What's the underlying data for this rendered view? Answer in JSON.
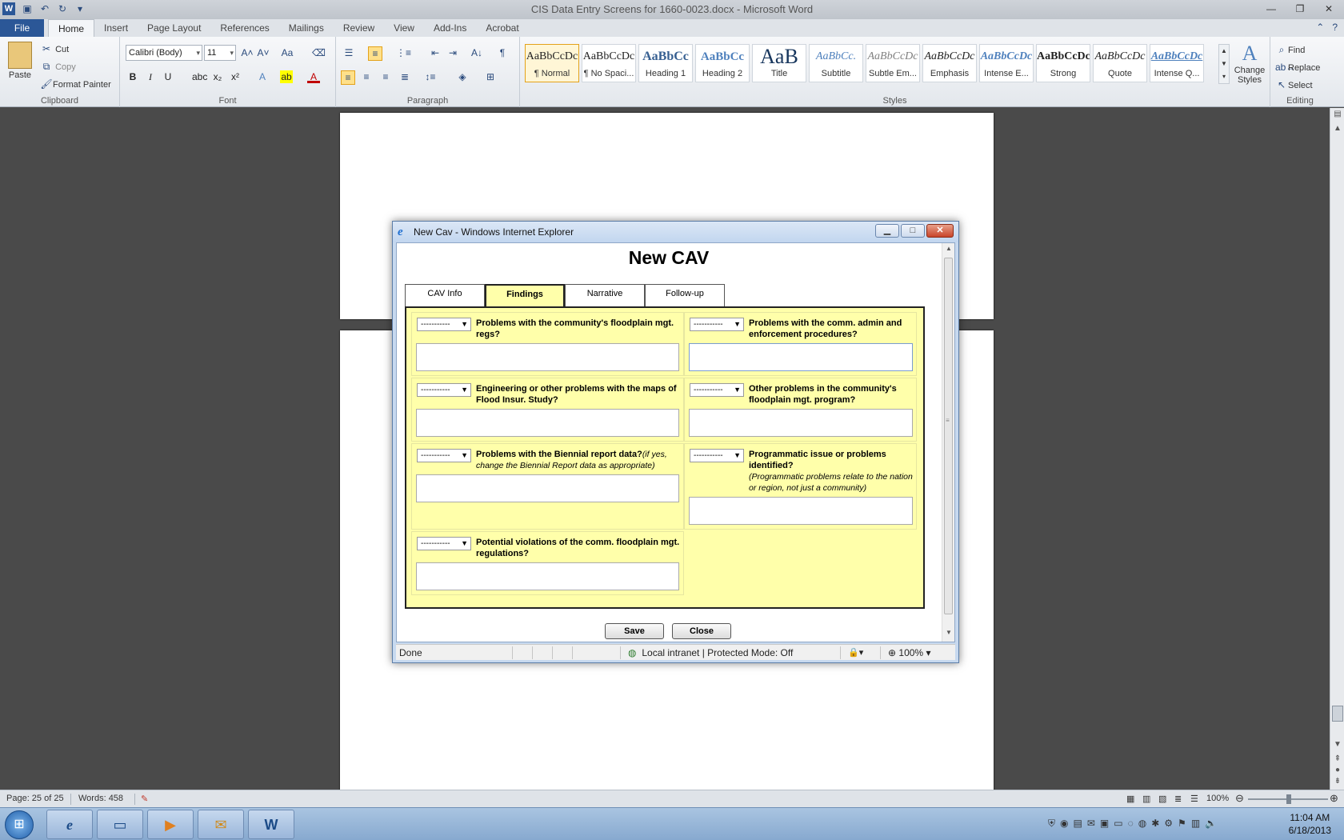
{
  "word": {
    "title": "CIS Data Entry Screens for 1660-0023.docx - Microsoft Word",
    "file_tab": "File",
    "tabs": [
      "Home",
      "Insert",
      "Page Layout",
      "References",
      "Mailings",
      "Review",
      "View",
      "Add-Ins",
      "Acrobat"
    ],
    "clipboard": {
      "paste": "Paste",
      "cut": "Cut",
      "copy": "Copy",
      "format_painter": "Format Painter",
      "label": "Clipboard"
    },
    "font": {
      "name": "Calibri (Body)",
      "size": "11",
      "label": "Font"
    },
    "paragraph": {
      "label": "Paragraph"
    },
    "styles": {
      "label": "Styles",
      "items": [
        {
          "sample": "AaBbCcDc",
          "name": "¶ Normal"
        },
        {
          "sample": "AaBbCcDc",
          "name": "¶ No Spaci..."
        },
        {
          "sample": "AaBbCc",
          "name": "Heading 1"
        },
        {
          "sample": "AaBbCc",
          "name": "Heading 2"
        },
        {
          "sample": "AaB",
          "name": "Title"
        },
        {
          "sample": "AaBbCc.",
          "name": "Subtitle"
        },
        {
          "sample": "AaBbCcDc",
          "name": "Subtle Em..."
        },
        {
          "sample": "AaBbCcDc",
          "name": "Emphasis"
        },
        {
          "sample": "AaBbCcDc",
          "name": "Intense E..."
        },
        {
          "sample": "AaBbCcDc",
          "name": "Strong"
        },
        {
          "sample": "AaBbCcDc",
          "name": "Quote"
        },
        {
          "sample": "AaBbCcDc",
          "name": "Intense Q..."
        }
      ],
      "change_styles": "Change Styles"
    },
    "editing": {
      "find": "Find",
      "replace": "Replace",
      "select": "Select",
      "label": "Editing"
    },
    "status": {
      "page": "Page: 25 of 25",
      "words": "Words: 458",
      "zoom": "100%"
    }
  },
  "ie": {
    "title": "New Cav - Windows Internet Explorer",
    "status_done": "Done",
    "status_zone": "Local intranet | Protected Mode: Off",
    "status_zoom": "100%"
  },
  "form": {
    "title": "New CAV",
    "tabs": [
      "CAV Info",
      "Findings",
      "Narrative",
      "Follow-up"
    ],
    "active_tab": "Findings",
    "select_placeholder": "-----------",
    "questions": [
      {
        "text": "Problems with the community's floodplain mgt. regs?",
        "note": ""
      },
      {
        "text": "Problems with the comm. admin and enforcement procedures?",
        "note": ""
      },
      {
        "text": "Engineering or other problems with the maps of Flood Insur. Study?",
        "note": ""
      },
      {
        "text": "Other problems in the community's floodplain mgt. program?",
        "note": ""
      },
      {
        "text": "Problems with the Biennial report data?",
        "note": "(if yes, change the Biennial Report data as appropriate)"
      },
      {
        "text": "Programmatic issue or problems identified?",
        "note": "(Programmatic problems relate to the nation or region, not just a community)"
      },
      {
        "text": "Potential violations of the comm. floodplain mgt. regulations?",
        "note": ""
      }
    ],
    "save": "Save",
    "close": "Close"
  },
  "taskbar": {
    "time": "11:04 AM",
    "date": "6/18/2013"
  }
}
